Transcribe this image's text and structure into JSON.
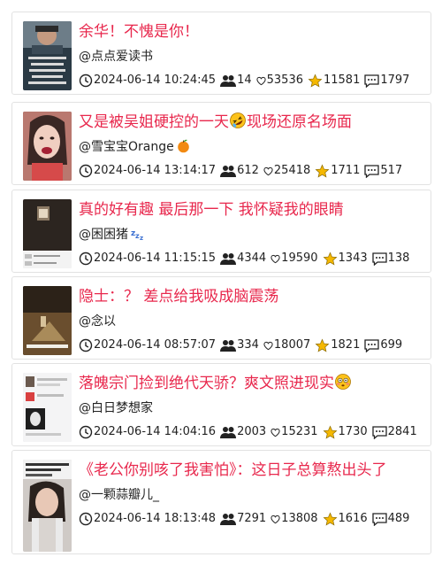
{
  "items": [
    {
      "title": "余华！不愧是你！",
      "author": "@点点爱读书",
      "datetime": "2024-06-14 10:24:45",
      "followers": "14",
      "likes": "53536",
      "stars": "11581",
      "comments": "1797",
      "thumb_color": "#2b3a45"
    },
    {
      "title": "又是被吴姐硬控的一天",
      "title_suffix": "现场还原名场面",
      "title_emoji": "rofl-emoji",
      "author": "@雪宝宝Orange",
      "author_emoji": "tangerine-emoji",
      "datetime": "2024-06-14 13:14:17",
      "followers": "612",
      "likes": "25418",
      "stars": "1711",
      "comments": "517",
      "thumb_color": "#7a5f4f"
    },
    {
      "title": "真的好有趣 最后那一下 我怀疑我的眼睛",
      "author": "@困困猪",
      "author_emoji": "sleeping-emoji",
      "datetime": "2024-06-14 11:15:15",
      "followers": "4344",
      "likes": "19590",
      "stars": "1343",
      "comments": "138",
      "thumb_color": "#2c2520"
    },
    {
      "title": "隐士：？ 差点给我吸成脑震荡",
      "author": "@念以",
      "datetime": "2024-06-14 08:57:07",
      "followers": "334",
      "likes": "18007",
      "stars": "1821",
      "comments": "699",
      "thumb_color": "#4a3a28"
    },
    {
      "title": "落魄宗门捡到绝代天骄？爽文照进现实",
      "title_emoji": "flushed-emoji",
      "author": "@白日梦想家",
      "datetime": "2024-06-14 14:04:16",
      "followers": "2003",
      "likes": "15231",
      "stars": "1730",
      "comments": "2841",
      "thumb_color": "#e9e9ea"
    },
    {
      "title": "《老公你别咳了我害怕》：这日子总算熬出头了",
      "author": "@一颗蒜瓣儿_",
      "datetime": "2024-06-14 18:13:48",
      "followers": "7291",
      "likes": "13808",
      "stars": "1616",
      "comments": "489",
      "thumb_color": "#cfcac6"
    }
  ],
  "colors": {
    "title": "#e8284d",
    "star": "#f5b800",
    "border": "#e2e2e2"
  }
}
